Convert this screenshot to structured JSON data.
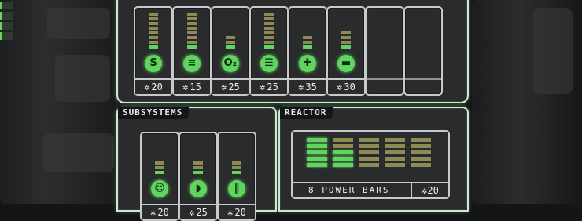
{
  "systems": [
    {
      "icon": "shields-icon",
      "glyph": "S",
      "level": 1,
      "bars": 8,
      "cost": "20"
    },
    {
      "icon": "engines-icon",
      "glyph": "≡",
      "level": 1,
      "bars": 8,
      "cost": "15"
    },
    {
      "icon": "oxygen-icon",
      "glyph": "O₂",
      "level": 1,
      "bars": 3,
      "cost": "25"
    },
    {
      "icon": "weapons-icon",
      "glyph": "☰",
      "level": 1,
      "bars": 8,
      "cost": "25"
    },
    {
      "icon": "medbay-icon",
      "glyph": "✚",
      "level": 1,
      "bars": 3,
      "cost": "35"
    },
    {
      "icon": "drones-icon",
      "glyph": "▬",
      "level": 1,
      "bars": 4,
      "cost": "30"
    },
    {
      "empty": true
    },
    {
      "empty": true
    }
  ],
  "subsystems": {
    "title": "SUBSYSTEMS",
    "items": [
      {
        "icon": "piloting-icon",
        "glyph": "☺",
        "level": 1,
        "bars": 3,
        "cost": "20"
      },
      {
        "icon": "sensors-icon",
        "glyph": "◗",
        "level": 1,
        "bars": 3,
        "cost": "25"
      },
      {
        "icon": "doors-icon",
        "glyph": "∥",
        "level": 1,
        "bars": 3,
        "cost": "20"
      }
    ]
  },
  "reactor": {
    "title": "REACTOR",
    "label": "8 POWER BARS",
    "cost": "20",
    "powered": 8,
    "total": 25
  },
  "gear_symbol": "✲",
  "colors": {
    "power_on": "#5fd45f",
    "power_off": "#8d8a54",
    "frame": "#cfe8d2"
  }
}
